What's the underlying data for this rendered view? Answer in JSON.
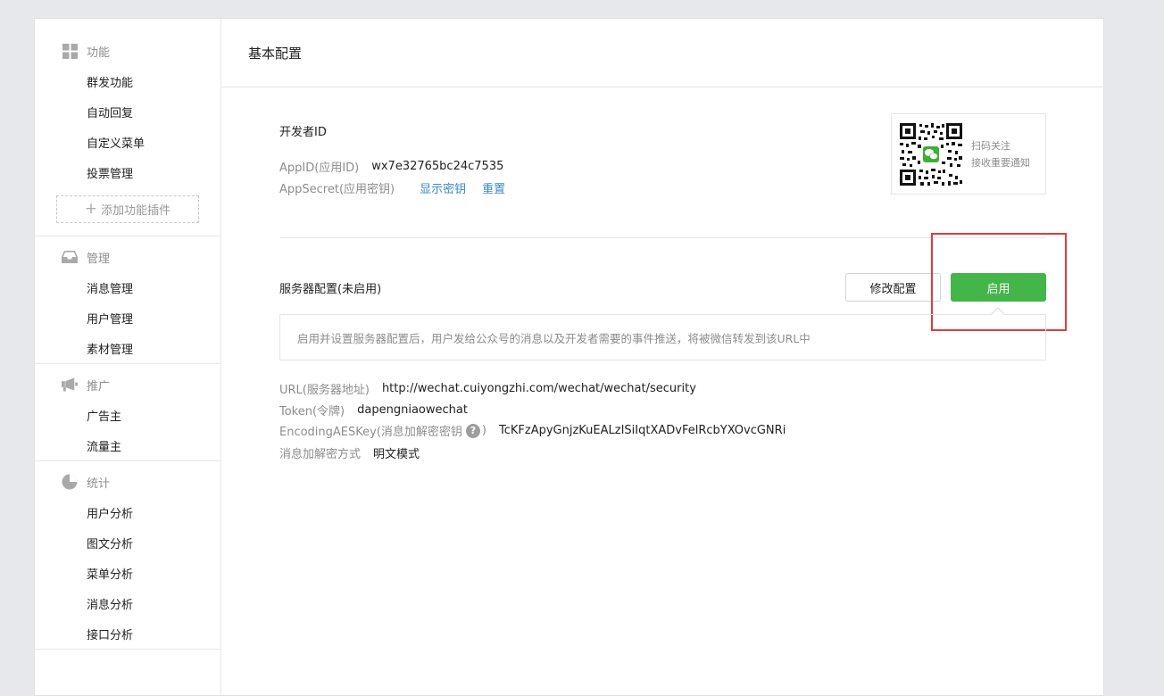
{
  "sidebar": {
    "sections": [
      {
        "title": "功能",
        "icon": "grid-icon",
        "items": [
          "群发功能",
          "自动回复",
          "自定义菜单",
          "投票管理"
        ],
        "add_plugin": "添加功能插件"
      },
      {
        "title": "管理",
        "icon": "inbox-icon",
        "items": [
          "消息管理",
          "用户管理",
          "素材管理"
        ]
      },
      {
        "title": "推广",
        "icon": "megaphone-icon",
        "items": [
          "广告主",
          "流量主"
        ]
      },
      {
        "title": "统计",
        "icon": "pie-chart-icon",
        "items": [
          "用户分析",
          "图文分析",
          "菜单分析",
          "消息分析",
          "接口分析"
        ]
      }
    ]
  },
  "main": {
    "title": "基本配置",
    "developer": {
      "title": "开发者ID",
      "appid_label": "AppID(应用ID)",
      "appid_value": "wx7e32765bc24c7535",
      "secret_label": "AppSecret(应用密钥)",
      "show_secret": "显示密钥",
      "reset": "重置"
    },
    "qr": {
      "line1": "扫码关注",
      "line2": "接收重要通知"
    },
    "server": {
      "title": "服务器配置(未启用)",
      "modify_button": "修改配置",
      "enable_button": "启用",
      "tip": "启用并设置服务器配置后，用户发给公众号的消息以及开发者需要的事件推送，将被微信转发到该URL中",
      "url_label": "URL(服务器地址)",
      "url_value": "http://wechat.cuiyongzhi.com/wechat/wechat/security",
      "token_label": "Token(令牌)",
      "token_value": "dapengniaowechat",
      "aes_label_pre": "EncodingAESKey(消息加解密密钥",
      "aes_help": "?",
      "aes_label_post": ")",
      "aes_value": "TcKFzApyGnjzKuEALzISiIqtXADvFelRcbYXOvcGNRi",
      "mode_label": "消息加解密方式",
      "mode_value": "明文模式"
    }
  },
  "colors": {
    "accent_green": "#44b549",
    "link_blue": "#3b88c4",
    "highlight_red": "#e13b3b"
  }
}
